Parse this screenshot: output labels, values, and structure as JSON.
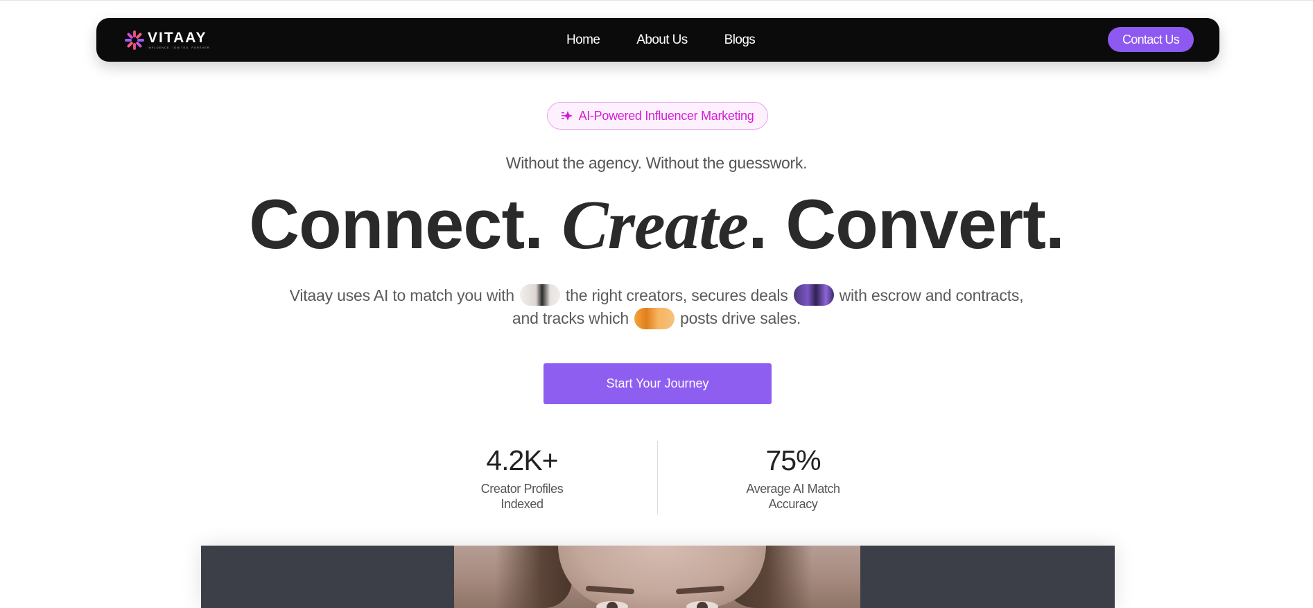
{
  "nav": {
    "logo_text": "VITAAY",
    "logo_tagline": "INFLUENCE. IGNITED. FOREVER.",
    "links": [
      "Home",
      "About Us",
      "Blogs"
    ],
    "contact_label": "Contact Us"
  },
  "hero": {
    "badge": "AI-Powered Influencer Marketing",
    "tagline": "Without the agency. Without the guesswork.",
    "headline": {
      "part1": "Connect.",
      "part2": "Create",
      "part3": ". Convert."
    },
    "subtext": {
      "s1": "Vitaay uses AI to match you with",
      "s2": "the right creators, secures deals",
      "s3": "with escrow and contracts,",
      "s4": "and tracks which",
      "s5": "posts drive sales."
    },
    "cta_label": "Start Your Journey"
  },
  "stats": [
    {
      "value": "4.2K+",
      "label_line1": "Creator Profiles",
      "label_line2": "Indexed"
    },
    {
      "value": "75%",
      "label_line1": "Average AI Match",
      "label_line2": "Accuracy"
    }
  ],
  "colors": {
    "accent": "#8e5ef0",
    "badge_text": "#d21fd6",
    "navbar_bg": "#0b0b0b"
  },
  "icons": [
    "logo-star-icon",
    "sparkle-icon"
  ]
}
